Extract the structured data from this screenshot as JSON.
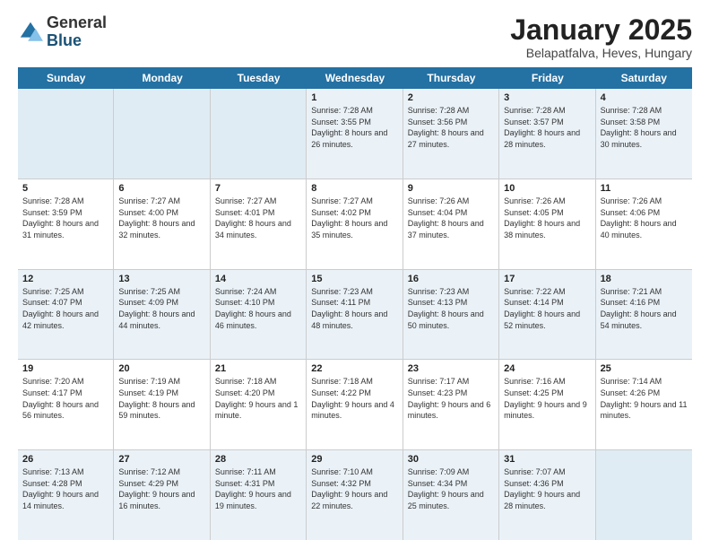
{
  "logo": {
    "general": "General",
    "blue": "Blue"
  },
  "title": "January 2025",
  "subtitle": "Belapatfalva, Heves, Hungary",
  "days_of_week": [
    "Sunday",
    "Monday",
    "Tuesday",
    "Wednesday",
    "Thursday",
    "Friday",
    "Saturday"
  ],
  "weeks": [
    [
      {
        "day": "",
        "info": ""
      },
      {
        "day": "",
        "info": ""
      },
      {
        "day": "",
        "info": ""
      },
      {
        "day": "1",
        "info": "Sunrise: 7:28 AM\nSunset: 3:55 PM\nDaylight: 8 hours and 26 minutes."
      },
      {
        "day": "2",
        "info": "Sunrise: 7:28 AM\nSunset: 3:56 PM\nDaylight: 8 hours and 27 minutes."
      },
      {
        "day": "3",
        "info": "Sunrise: 7:28 AM\nSunset: 3:57 PM\nDaylight: 8 hours and 28 minutes."
      },
      {
        "day": "4",
        "info": "Sunrise: 7:28 AM\nSunset: 3:58 PM\nDaylight: 8 hours and 30 minutes."
      }
    ],
    [
      {
        "day": "5",
        "info": "Sunrise: 7:28 AM\nSunset: 3:59 PM\nDaylight: 8 hours and 31 minutes."
      },
      {
        "day": "6",
        "info": "Sunrise: 7:27 AM\nSunset: 4:00 PM\nDaylight: 8 hours and 32 minutes."
      },
      {
        "day": "7",
        "info": "Sunrise: 7:27 AM\nSunset: 4:01 PM\nDaylight: 8 hours and 34 minutes."
      },
      {
        "day": "8",
        "info": "Sunrise: 7:27 AM\nSunset: 4:02 PM\nDaylight: 8 hours and 35 minutes."
      },
      {
        "day": "9",
        "info": "Sunrise: 7:26 AM\nSunset: 4:04 PM\nDaylight: 8 hours and 37 minutes."
      },
      {
        "day": "10",
        "info": "Sunrise: 7:26 AM\nSunset: 4:05 PM\nDaylight: 8 hours and 38 minutes."
      },
      {
        "day": "11",
        "info": "Sunrise: 7:26 AM\nSunset: 4:06 PM\nDaylight: 8 hours and 40 minutes."
      }
    ],
    [
      {
        "day": "12",
        "info": "Sunrise: 7:25 AM\nSunset: 4:07 PM\nDaylight: 8 hours and 42 minutes."
      },
      {
        "day": "13",
        "info": "Sunrise: 7:25 AM\nSunset: 4:09 PM\nDaylight: 8 hours and 44 minutes."
      },
      {
        "day": "14",
        "info": "Sunrise: 7:24 AM\nSunset: 4:10 PM\nDaylight: 8 hours and 46 minutes."
      },
      {
        "day": "15",
        "info": "Sunrise: 7:23 AM\nSunset: 4:11 PM\nDaylight: 8 hours and 48 minutes."
      },
      {
        "day": "16",
        "info": "Sunrise: 7:23 AM\nSunset: 4:13 PM\nDaylight: 8 hours and 50 minutes."
      },
      {
        "day": "17",
        "info": "Sunrise: 7:22 AM\nSunset: 4:14 PM\nDaylight: 8 hours and 52 minutes."
      },
      {
        "day": "18",
        "info": "Sunrise: 7:21 AM\nSunset: 4:16 PM\nDaylight: 8 hours and 54 minutes."
      }
    ],
    [
      {
        "day": "19",
        "info": "Sunrise: 7:20 AM\nSunset: 4:17 PM\nDaylight: 8 hours and 56 minutes."
      },
      {
        "day": "20",
        "info": "Sunrise: 7:19 AM\nSunset: 4:19 PM\nDaylight: 8 hours and 59 minutes."
      },
      {
        "day": "21",
        "info": "Sunrise: 7:18 AM\nSunset: 4:20 PM\nDaylight: 9 hours and 1 minute."
      },
      {
        "day": "22",
        "info": "Sunrise: 7:18 AM\nSunset: 4:22 PM\nDaylight: 9 hours and 4 minutes."
      },
      {
        "day": "23",
        "info": "Sunrise: 7:17 AM\nSunset: 4:23 PM\nDaylight: 9 hours and 6 minutes."
      },
      {
        "day": "24",
        "info": "Sunrise: 7:16 AM\nSunset: 4:25 PM\nDaylight: 9 hours and 9 minutes."
      },
      {
        "day": "25",
        "info": "Sunrise: 7:14 AM\nSunset: 4:26 PM\nDaylight: 9 hours and 11 minutes."
      }
    ],
    [
      {
        "day": "26",
        "info": "Sunrise: 7:13 AM\nSunset: 4:28 PM\nDaylight: 9 hours and 14 minutes."
      },
      {
        "day": "27",
        "info": "Sunrise: 7:12 AM\nSunset: 4:29 PM\nDaylight: 9 hours and 16 minutes."
      },
      {
        "day": "28",
        "info": "Sunrise: 7:11 AM\nSunset: 4:31 PM\nDaylight: 9 hours and 19 minutes."
      },
      {
        "day": "29",
        "info": "Sunrise: 7:10 AM\nSunset: 4:32 PM\nDaylight: 9 hours and 22 minutes."
      },
      {
        "day": "30",
        "info": "Sunrise: 7:09 AM\nSunset: 4:34 PM\nDaylight: 9 hours and 25 minutes."
      },
      {
        "day": "31",
        "info": "Sunrise: 7:07 AM\nSunset: 4:36 PM\nDaylight: 9 hours and 28 minutes."
      },
      {
        "day": "",
        "info": ""
      }
    ]
  ],
  "alt_rows": [
    0,
    2,
    4
  ]
}
